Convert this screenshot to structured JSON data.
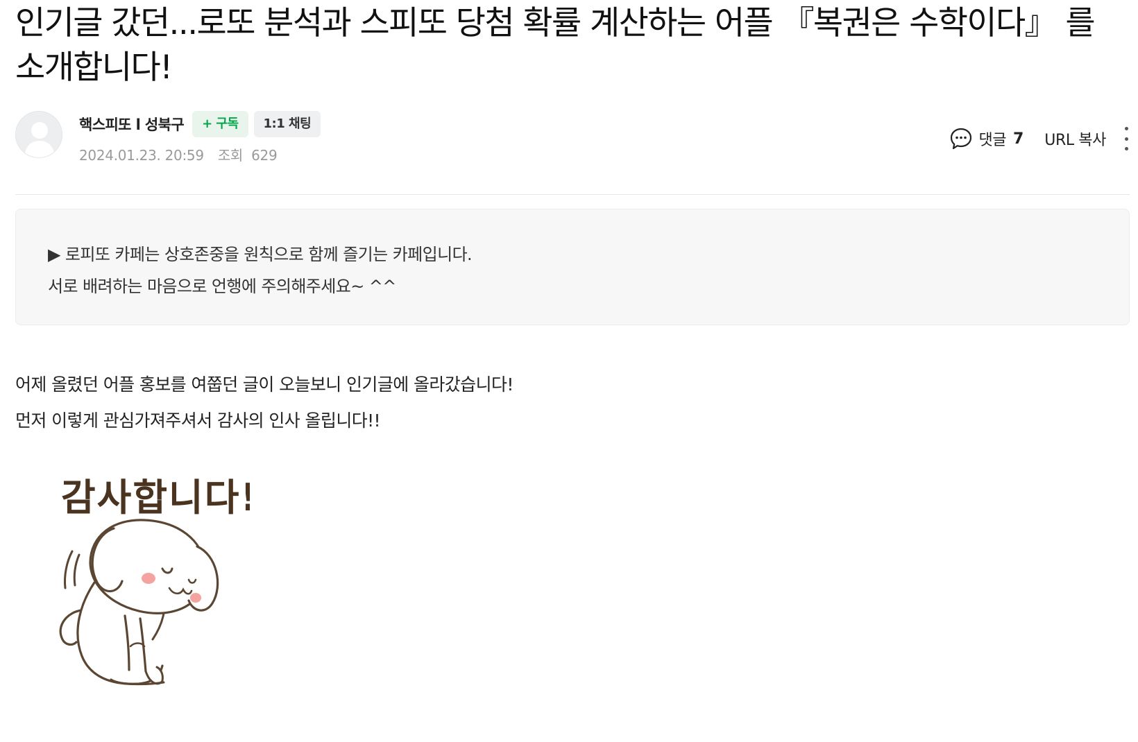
{
  "post": {
    "title": "인기글 갔던...로또 분석과 스피또 당첨 확률 계산하는 어플 『복권은 수학이다』 를 소개합니다!"
  },
  "author": {
    "name": "핵스피또 l 성북구",
    "subscribe_label": "+ 구독",
    "chat_label": "1:1 채팅",
    "date": "2024.01.23. 20:59",
    "views_label": "조회",
    "views_count": "629"
  },
  "actions": {
    "comment_label": "댓글",
    "comment_count": "7",
    "url_copy_label": "URL 복사",
    "more_icon": "more-vertical-icon",
    "comment_icon": "speech-bubble-icon"
  },
  "notice": {
    "line1": "▶ 로피또 카페는 상호존중을 원칙으로 함께 즐기는 카페입니다.",
    "line2": "서로 배려하는 마음으로 언행에 주의해주세요~ ^^"
  },
  "body": {
    "line1": "어제 올렸던 어플 홍보를 여쭙던 글이 오늘보니 인기글에 올라갔습니다!",
    "line2": "먼저 이렇게 관심가져주셔서 감사의 인사 올립니다!!"
  },
  "sticker": {
    "caption": "감사합니다!"
  },
  "colors": {
    "subscribe_green": "#03a64a",
    "subscribe_bg": "#e9f5ec",
    "meta_gray": "#9a9a9a",
    "notice_bg": "#f7f7f7"
  }
}
